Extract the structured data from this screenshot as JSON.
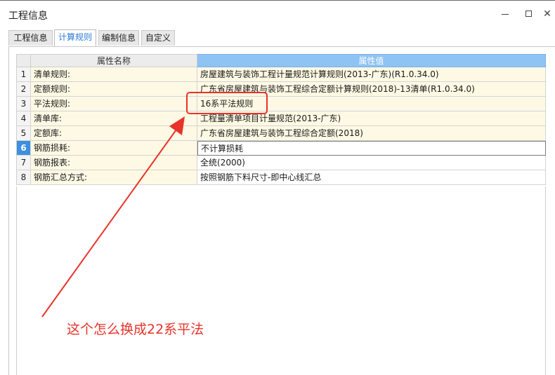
{
  "window": {
    "title": "工程信息",
    "controls": {
      "minimize": "—",
      "maximize": "☐",
      "close": "✕"
    }
  },
  "tabs": [
    {
      "label": "工程信息",
      "active": false
    },
    {
      "label": "计算规则",
      "active": true
    },
    {
      "label": "编制信息",
      "active": false
    },
    {
      "label": "自定义",
      "active": false
    }
  ],
  "table": {
    "headers": {
      "name": "属性名称",
      "value": "属性值"
    },
    "rows": [
      {
        "num": "1",
        "name": "清单规则:",
        "value": "房屋建筑与装饰工程计量规范计算规则(2013-广东)(R1.0.34.0)"
      },
      {
        "num": "2",
        "name": "定额规则:",
        "value": "广东省房屋建筑与装饰工程综合定额计算规则(2018)-13清单(R1.0.34.0)"
      },
      {
        "num": "3",
        "name": "平法规则:",
        "value": "16系平法规则"
      },
      {
        "num": "4",
        "name": "清单库:",
        "value": "工程量清单项目计量规范(2013-广东)"
      },
      {
        "num": "5",
        "name": "定额库:",
        "value": "广东省房屋建筑与装饰工程综合定额(2018)"
      },
      {
        "num": "6",
        "name": "钢筋损耗:",
        "value": "不计算损耗"
      },
      {
        "num": "7",
        "name": "钢筋报表:",
        "value": "全统(2000)"
      },
      {
        "num": "8",
        "name": "钢筋汇总方式:",
        "value": "按照钢筋下料尺寸-即中心线汇总"
      }
    ],
    "selected_row": "6"
  },
  "annotation": {
    "text": "这个怎么换成22系平法",
    "color": "#e8322a"
  },
  "colors": {
    "header_value_bg": "#8fc3f4",
    "row_bg": "#fdf9e4",
    "selected_num_bg": "#3d8fe0",
    "tab_active_text": "#2b7bd6"
  }
}
